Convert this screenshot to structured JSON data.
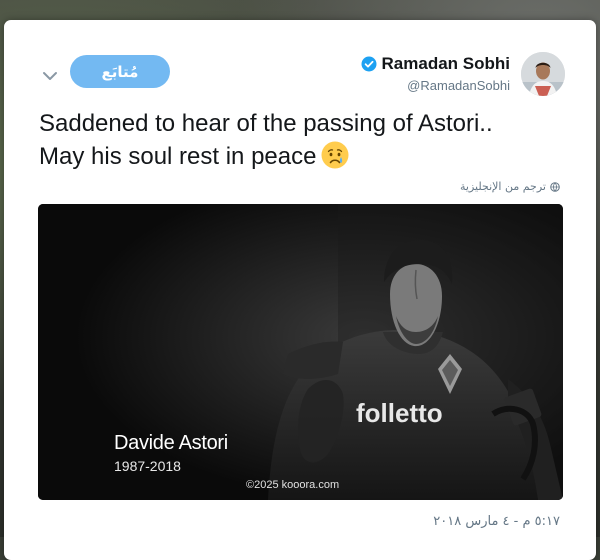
{
  "tweet": {
    "follow_label": "مُتابَع",
    "display_name": "Ramadan Sobhi",
    "handle": "@RamadanSobhi",
    "text_line1": "Saddened to hear of the passing of Astori..",
    "text_line2": "May his soul rest in peace",
    "emoji": "crying-face-emoji",
    "translate_label": "ترجم من الإنجليزية",
    "timestamp": "٥:١٧ م - ٤ مارس ٢٠١٨"
  },
  "media": {
    "player_name": "Davide Astori",
    "years": "1987-2018",
    "jersey_sponsor": "folletto",
    "watermark": "©2025 kooora.com"
  },
  "colors": {
    "follow_button": "#73b9f2",
    "verified_badge": "#1da1f2",
    "muted_text": "#657786"
  }
}
